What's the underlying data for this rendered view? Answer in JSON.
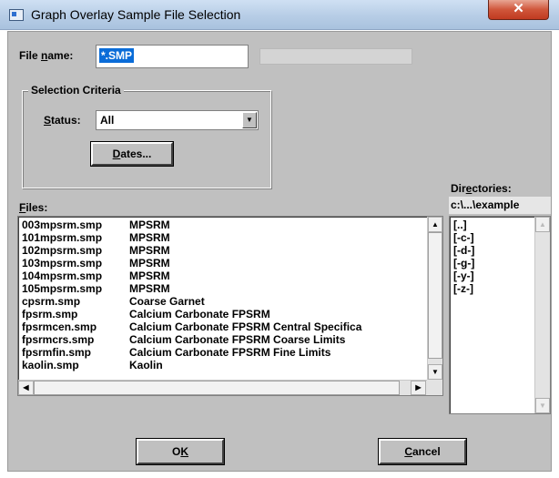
{
  "window": {
    "title": "Graph Overlay Sample File Selection",
    "close_glyph": "✕"
  },
  "file_name": {
    "label_pre": "File ",
    "label_ul": "n",
    "label_post": "ame:",
    "value": "*.SMP"
  },
  "selection_criteria": {
    "title": "Selection Criteria",
    "status_label_ul": "S",
    "status_label_post": "tatus:",
    "status_value": "All",
    "dates_button_ul": "D",
    "dates_button_post": "ates..."
  },
  "files": {
    "label_ul": "F",
    "label_post": "iles:",
    "rows": [
      {
        "name": "003mpsrm.smp",
        "desc": "MPSRM"
      },
      {
        "name": "101mpsrm.smp",
        "desc": "MPSRM"
      },
      {
        "name": "102mpsrm.smp",
        "desc": "MPSRM"
      },
      {
        "name": "103mpsrm.smp",
        "desc": "MPSRM"
      },
      {
        "name": "104mpsrm.smp",
        "desc": "MPSRM"
      },
      {
        "name": "105mpsrm.smp",
        "desc": "MPSRM"
      },
      {
        "name": "cpsrm.smp",
        "desc": "Coarse Garnet"
      },
      {
        "name": "fpsrm.smp",
        "desc": "Calcium Carbonate FPSRM"
      },
      {
        "name": "fpsrmcen.smp",
        "desc": "Calcium Carbonate FPSRM Central Specifica"
      },
      {
        "name": "fpsrmcrs.smp",
        "desc": "Calcium Carbonate FPSRM Coarse Limits"
      },
      {
        "name": "fpsrmfin.smp",
        "desc": "Calcium Carbonate FPSRM Fine Limits"
      },
      {
        "name": "kaolin.smp",
        "desc": "Kaolin"
      }
    ]
  },
  "directories": {
    "label_pre": "Dir",
    "label_ul": "e",
    "label_post": "ctories:",
    "current_path": "c:\\...\\example",
    "items": [
      "[..]",
      "[-c-]",
      "[-d-]",
      "[-g-]",
      "[-y-]",
      "[-z-]"
    ]
  },
  "buttons": {
    "ok_pre": "O",
    "ok_ul": "K",
    "cancel_ul": "C",
    "cancel_post": "ancel"
  }
}
